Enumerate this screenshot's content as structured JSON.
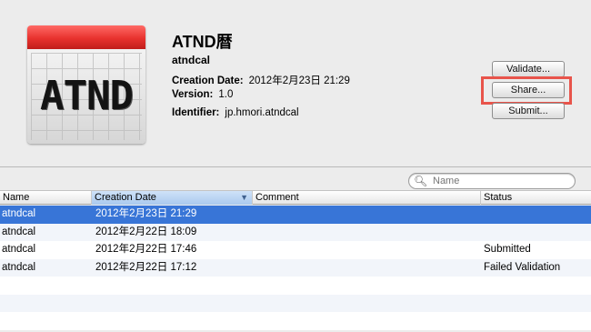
{
  "app": {
    "icon_text": "ATND",
    "title": "ATND暦",
    "bundle_name": "atndcal",
    "details": [
      {
        "key": "Creation Date:",
        "value": "2012年2月23日 21:29"
      },
      {
        "key": "Version:",
        "value": "1.0"
      },
      {
        "key": "Identifier:",
        "value": "jp.hmori.atndcal"
      }
    ]
  },
  "buttons": {
    "validate": "Validate...",
    "share": "Share...",
    "submit": "Submit..."
  },
  "search": {
    "placeholder": "Name",
    "value": ""
  },
  "table": {
    "columns": [
      "Name",
      "Creation Date",
      "Comment",
      "Status"
    ],
    "sorted_column": "Creation Date",
    "rows": [
      {
        "name": "atndcal",
        "date": "2012年2月23日 21:29",
        "comment": "",
        "status": "",
        "selected": true
      },
      {
        "name": "atndcal",
        "date": "2012年2月22日 18:09",
        "comment": "",
        "status": ""
      },
      {
        "name": "atndcal",
        "date": "2012年2月22日 17:46",
        "comment": "",
        "status": "Submitted"
      },
      {
        "name": "atndcal",
        "date": "2012年2月22日 17:12",
        "comment": "",
        "status": "Failed Validation"
      }
    ]
  },
  "colors": {
    "selection": "#3875d7",
    "highlight_box": "#e8544b"
  }
}
